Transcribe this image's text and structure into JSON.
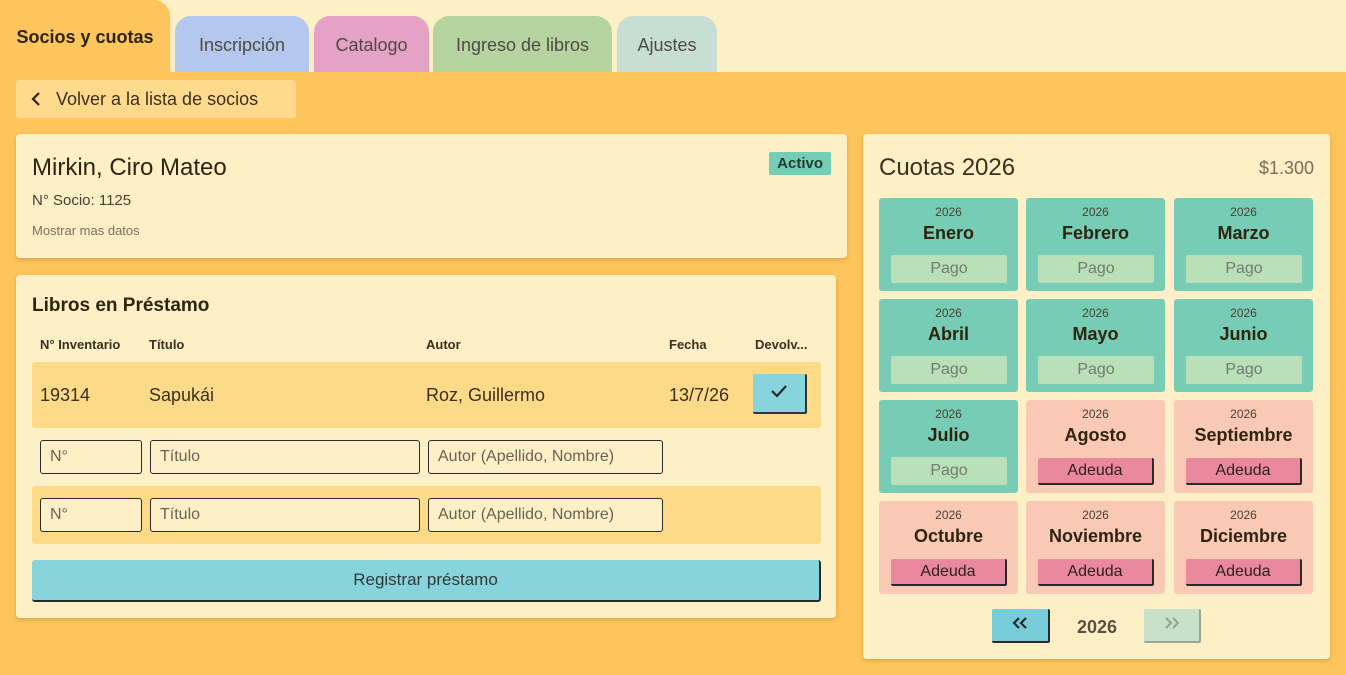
{
  "tabs": [
    {
      "label": "Socios y cuotas",
      "active": true
    },
    {
      "label": "Inscripción",
      "color": "#b3c8ec"
    },
    {
      "label": "Catalogo",
      "color": "#e6a2c4"
    },
    {
      "label": "Ingreso de libros",
      "color": "#b6d4a0"
    },
    {
      "label": "Ajustes",
      "color": "#c7ded5"
    }
  ],
  "back_label": "Volver a la lista de socios",
  "member": {
    "name": "Mirkin, Ciro Mateo",
    "number": "N° Socio: 1125",
    "more_data": "Mostrar mas datos",
    "status": "Activo"
  },
  "loans": {
    "title": "Libros en Préstamo",
    "headers": [
      "N° Inventario",
      "Título",
      "Autor",
      "Fecha",
      "Devolv..."
    ],
    "rows": [
      {
        "inventory": "19314",
        "title": "Sapukái",
        "author": "Roz, Guillermo",
        "date": "13/7/26"
      }
    ],
    "placeholders": {
      "number": "N°",
      "title": "Título",
      "author": "Autor (Apellido, Nombre)"
    },
    "register_label": "Registrar préstamo"
  },
  "fees": {
    "title": "Cuotas 2026",
    "amount": "$1.300",
    "months": [
      {
        "year": "2026",
        "name": "Enero",
        "status": "Pago",
        "paid": true
      },
      {
        "year": "2026",
        "name": "Febrero",
        "status": "Pago",
        "paid": true
      },
      {
        "year": "2026",
        "name": "Marzo",
        "status": "Pago",
        "paid": true
      },
      {
        "year": "2026",
        "name": "Abril",
        "status": "Pago",
        "paid": true
      },
      {
        "year": "2026",
        "name": "Mayo",
        "status": "Pago",
        "paid": true
      },
      {
        "year": "2026",
        "name": "Junio",
        "status": "Pago",
        "paid": true
      },
      {
        "year": "2026",
        "name": "Julio",
        "status": "Pago",
        "paid": true
      },
      {
        "year": "2026",
        "name": "Agosto",
        "status": "Adeuda",
        "paid": false
      },
      {
        "year": "2026",
        "name": "Septiembre",
        "status": "Adeuda",
        "paid": false
      },
      {
        "year": "2026",
        "name": "Octubre",
        "status": "Adeuda",
        "paid": false
      },
      {
        "year": "2026",
        "name": "Noviembre",
        "status": "Adeuda",
        "paid": false
      },
      {
        "year": "2026",
        "name": "Diciembre",
        "status": "Adeuda",
        "paid": false
      }
    ],
    "pager_year": "2026"
  },
  "icons": {
    "back": "chevron-left-icon",
    "check": "check-icon",
    "prev": "double-chevron-left-icon",
    "next": "double-chevron-right-icon"
  },
  "colors": {
    "background": "#fec55d",
    "card": "#fef0c6",
    "paid": "#77ccb5",
    "owed": "#f9c9b6",
    "owed_button": "#ea899d",
    "accent_button": "#87d4dc",
    "status_badge": "#76cdb5"
  }
}
